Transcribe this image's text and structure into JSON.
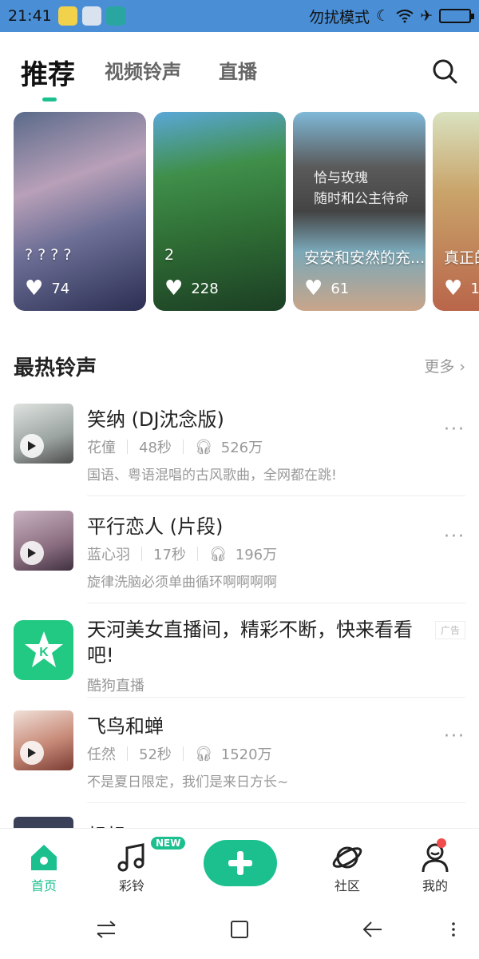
{
  "status_bar": {
    "time": "21:41",
    "dnd_label": "勿扰模式",
    "colors": {
      "background": "#4a8fd6"
    }
  },
  "top_nav": {
    "tabs": [
      {
        "label": "推荐",
        "active": true
      },
      {
        "label": "视频铃声",
        "active": false
      },
      {
        "label": "直播",
        "active": false
      }
    ],
    "search_icon": "search-icon"
  },
  "video_cards": [
    {
      "title": "? ? ? ?",
      "likes": "74"
    },
    {
      "title": "2",
      "likes": "228"
    },
    {
      "title": "安安和安然的充...",
      "likes": "61",
      "overlay_text": "恰与玫瑰\n随时和公主待命"
    },
    {
      "title": "真正的",
      "likes": "1"
    }
  ],
  "hot_section": {
    "title": "最热铃声",
    "more_label": "更多",
    "items": [
      {
        "name": "笑纳 (DJ沈念版)",
        "artist": "花僮",
        "duration": "48秒",
        "plays": "526万",
        "desc": "国语、粤语混唱的古风歌曲，全网都在跳!"
      },
      {
        "name": "平行恋人 (片段)",
        "artist": "蓝心羽",
        "duration": "17秒",
        "plays": "196万",
        "desc": "旋律洗脑必须单曲循环啊啊啊啊"
      },
      {
        "name": "飞鸟和蝉",
        "artist": "任然",
        "duration": "52秒",
        "plays": "1520万",
        "desc": "不是夏日限定，我们是来日方长~"
      }
    ],
    "ad": {
      "title": "天河美女直播间，精彩不断，快来看看吧!",
      "tag": "广告",
      "source": "酷狗直播"
    },
    "partial_next": "想想"
  },
  "bottom_nav": {
    "items": [
      {
        "label": "首页",
        "icon": "home-icon",
        "active": true
      },
      {
        "label": "彩铃",
        "icon": "music-note-icon",
        "badge": "NEW"
      },
      {
        "label": "",
        "icon": "plus-icon"
      },
      {
        "label": "社区",
        "icon": "planet-icon"
      },
      {
        "label": "我的",
        "icon": "profile-icon"
      }
    ],
    "accent": "#1cc08f"
  }
}
